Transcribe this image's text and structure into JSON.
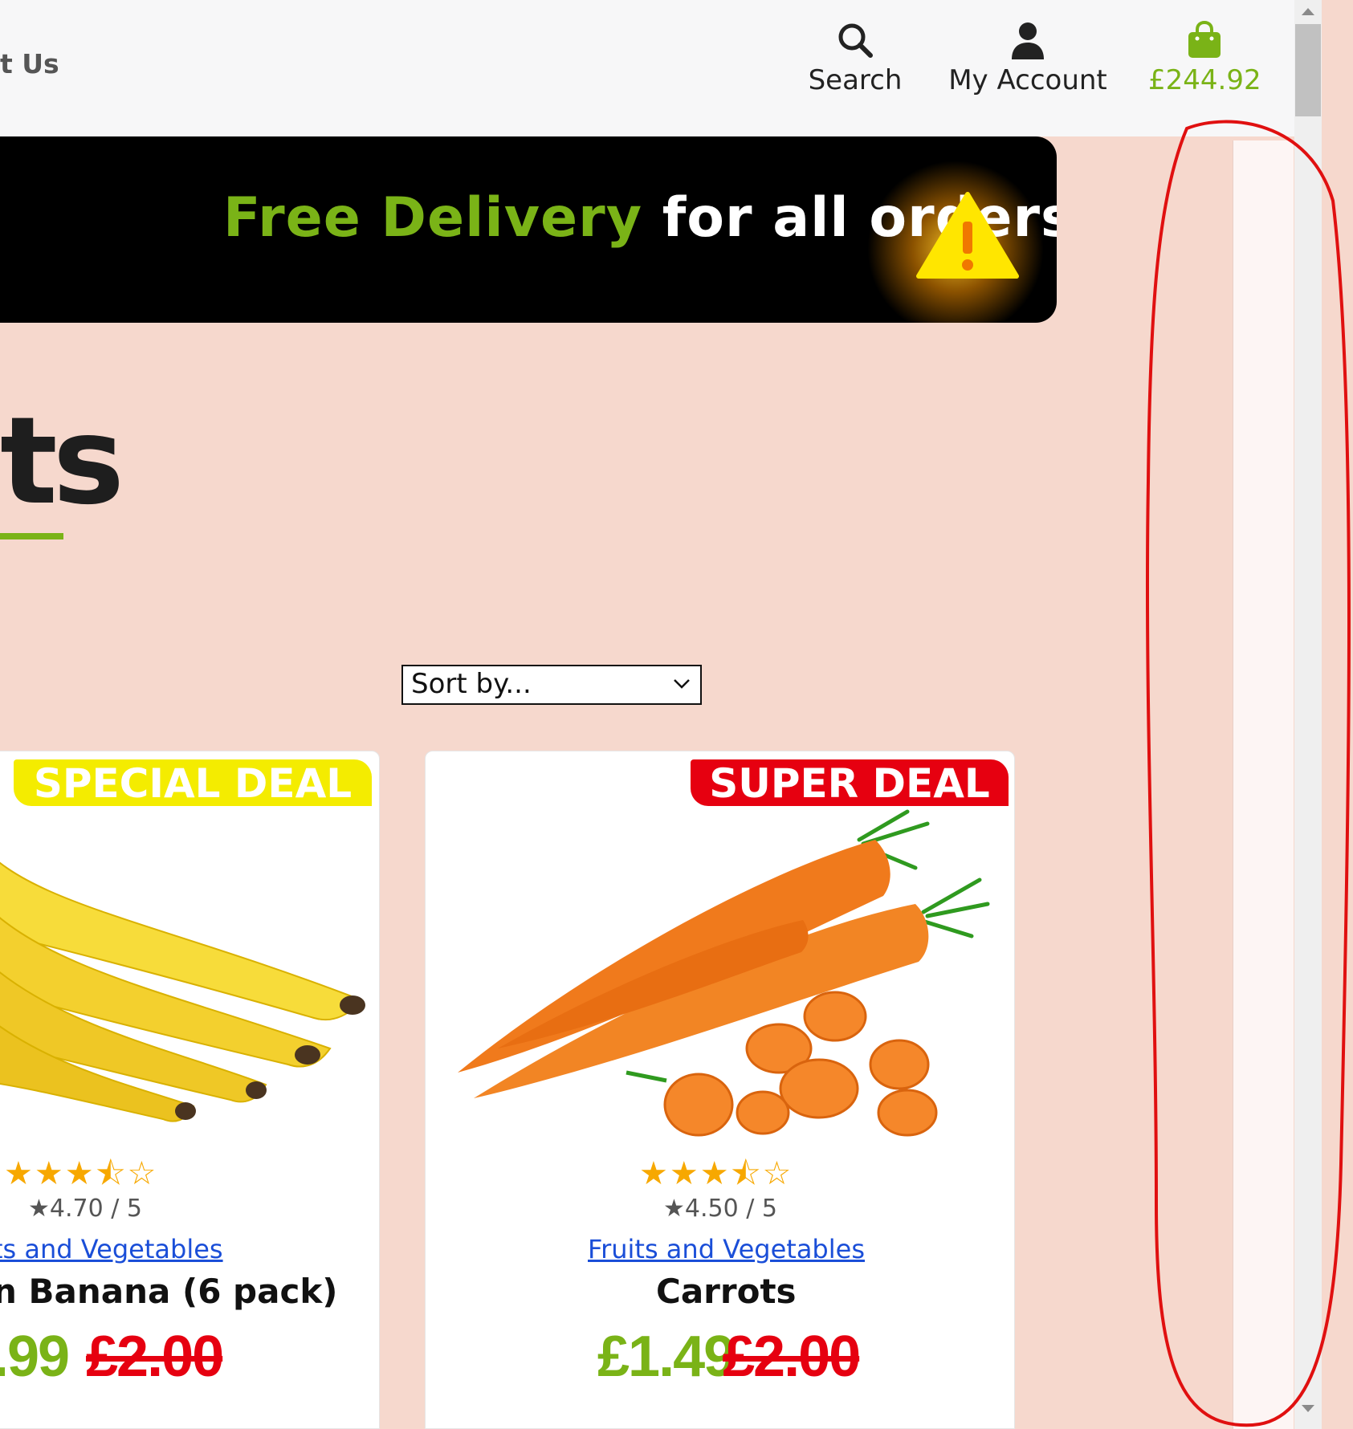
{
  "header": {
    "nav_fragment": "t Us",
    "search_label": "Search",
    "account_label": "My Account",
    "cart_total": "£244.92"
  },
  "banner": {
    "text_green": "Free Delivery",
    "text_white": " for all orders in:"
  },
  "page": {
    "heading_fragment": "ts"
  },
  "sort": {
    "selected": "Sort by..."
  },
  "products": [
    {
      "badge": "SPECIAL DEAL",
      "rating_stars": 3.5,
      "rating_text": "4.70 / 5",
      "category": "ts and Vegetables",
      "name": "Banana (6 pack)",
      "name_prefix_fragment": "n",
      "price": ".99",
      "old_price": "£2.00"
    },
    {
      "badge": "SUPER DEAL",
      "rating_stars": 3.5,
      "rating_text": "4.50 / 5",
      "category": "Fruits and Vegetables",
      "name": "Carrots",
      "price": "£1.49",
      "old_price": "£2.00"
    }
  ],
  "colors": {
    "brand_green": "#7ab317",
    "deal_red": "#e60010",
    "deal_yellow": "#f4ec00",
    "page_bg": "#f6d8cd",
    "annotation_red": "#e01010"
  },
  "icons": {
    "search": "search-icon",
    "account": "user-icon",
    "cart": "shopping-bag-icon",
    "warning": "warning-icon",
    "sort": "chevron-down-icon"
  }
}
